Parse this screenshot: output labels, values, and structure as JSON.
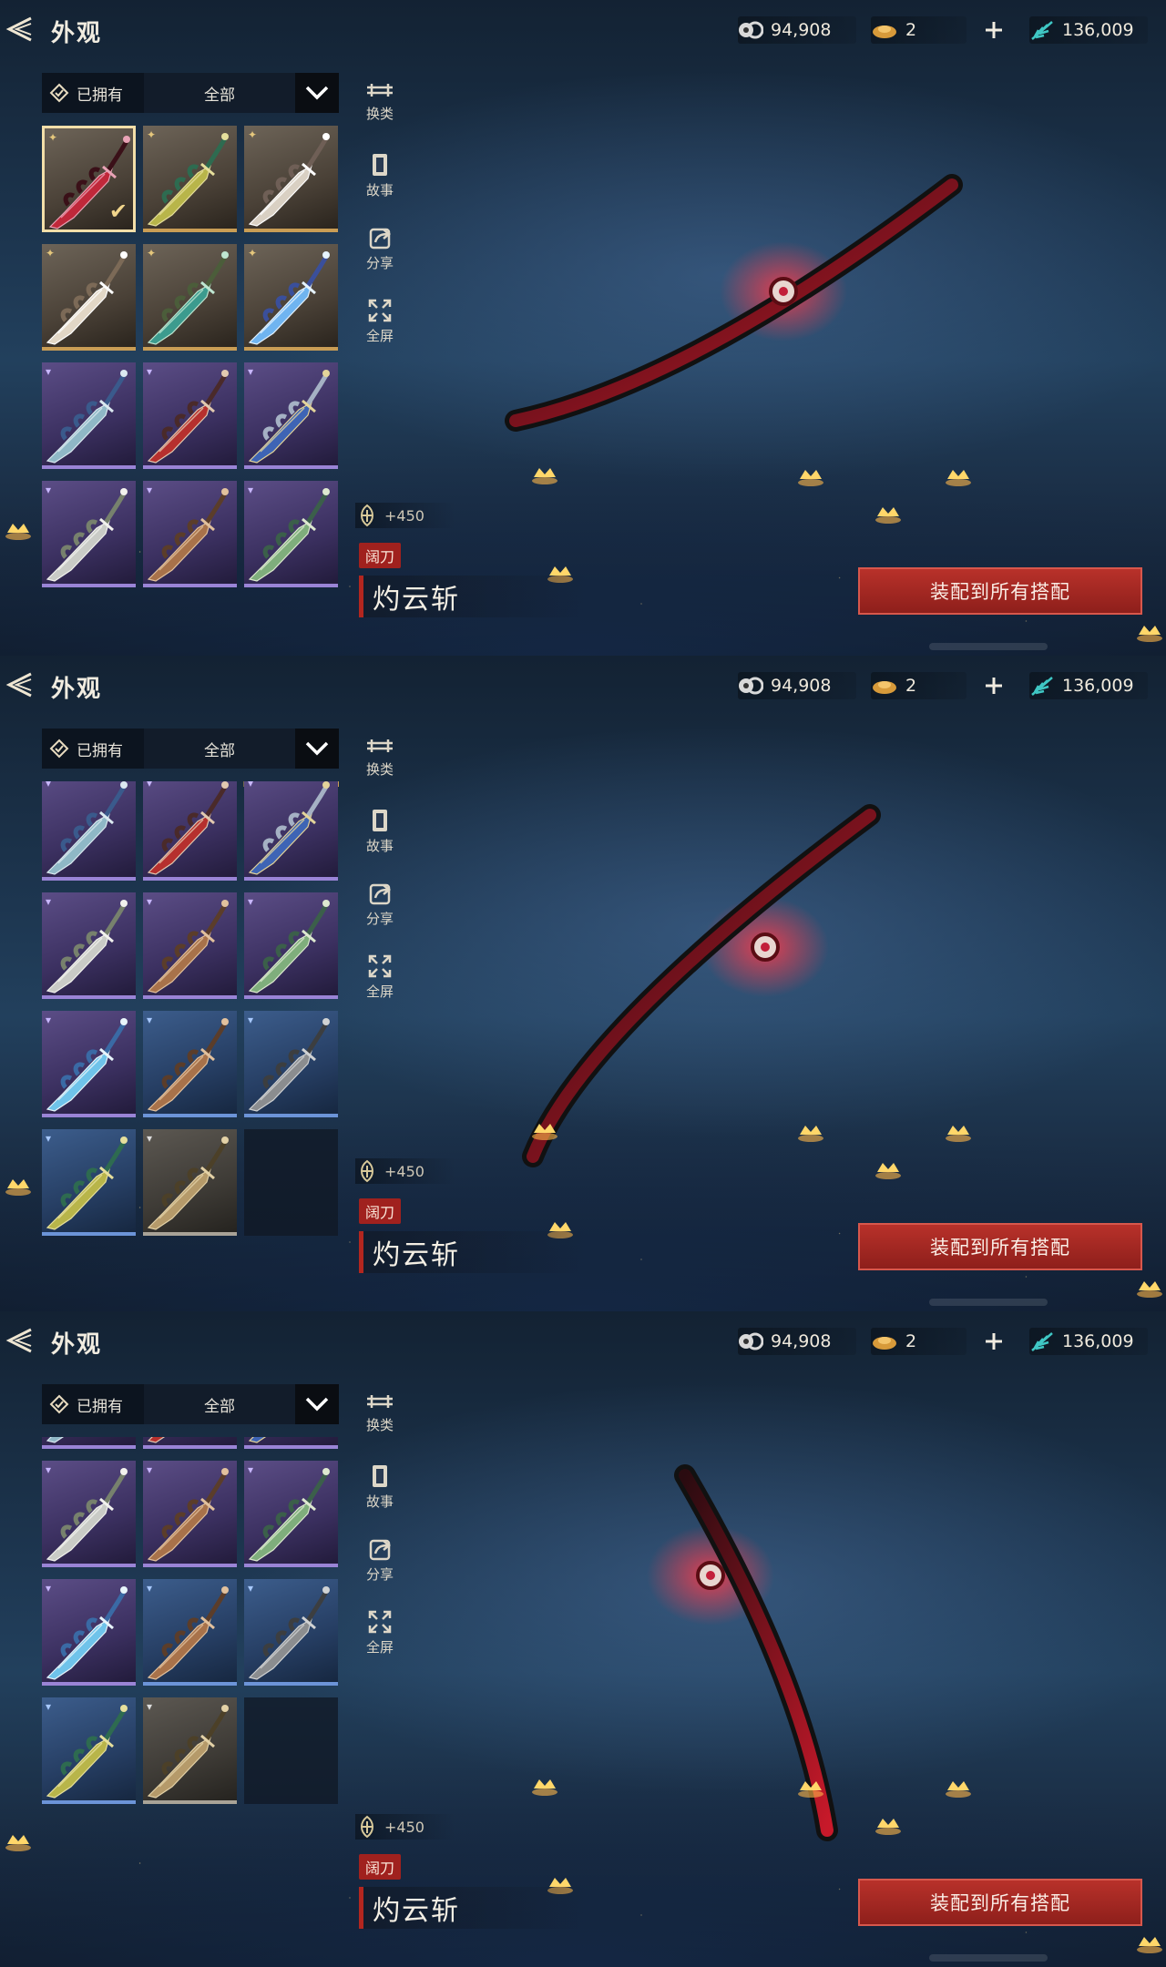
{
  "title": "外观",
  "currencies": {
    "jade": "94,908",
    "gold": "2",
    "feather": "136,009"
  },
  "filter": {
    "owned_label": "已拥有",
    "category_label": "全部"
  },
  "side_menu": {
    "switch": "换类",
    "story": "故事",
    "share": "分享",
    "fullscreen": "全屏"
  },
  "weapon": {
    "power": "+450",
    "type_tag": "阔刀",
    "name": "灼云斩"
  },
  "equip_button": "装配到所有搭配",
  "colors": {
    "gold_rarity": "#c99d55",
    "purple_rarity": "#9a84d6",
    "blue_rarity": "#6c94d8",
    "equip_red": "#a5281f"
  },
  "panels": [
    {
      "scroll_state": "top",
      "rows": [
        [
          "gold-selected-crimson",
          "gold-jade",
          "gold-white"
        ],
        [
          "gold-ivory",
          "gold-teal",
          "gold-azure"
        ],
        [
          "purple-cyan",
          "purple-red",
          "purple-blue"
        ],
        [
          "purple-silver",
          "purple-bronze",
          "purple-green"
        ]
      ]
    },
    {
      "scroll_state": "middle",
      "rows": [
        [
          "purple-cyan",
          "purple-red",
          "purple-blue"
        ],
        [
          "purple-silver",
          "purple-bronze",
          "purple-green"
        ],
        [
          "purple-ice",
          "blue-bronze",
          "blue-steel"
        ],
        [
          "blue-jade",
          "gray-gold",
          "empty"
        ]
      ]
    },
    {
      "scroll_state": "bottom",
      "rows": [
        [
          "purple-cyan",
          "purple-red",
          "purple-blue"
        ],
        [
          "purple-silver",
          "purple-bronze",
          "purple-green"
        ],
        [
          "purple-ice",
          "blue-bronze",
          "blue-steel"
        ],
        [
          "blue-jade",
          "gray-gold",
          "empty"
        ]
      ]
    }
  ]
}
